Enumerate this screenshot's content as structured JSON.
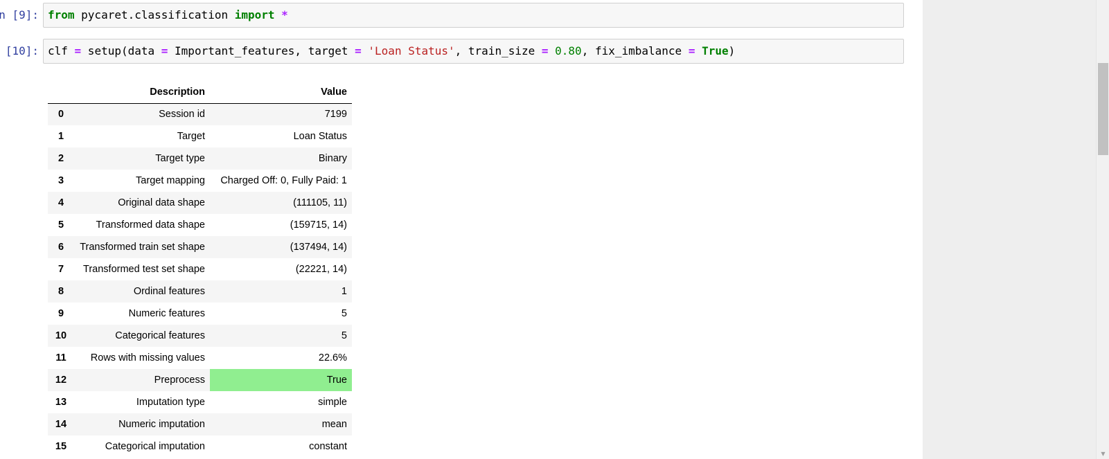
{
  "cells": [
    {
      "prompt": "n [9]:",
      "code": [
        {
          "t": "from",
          "c": "kw"
        },
        {
          "t": " pycaret.classification ",
          "c": ""
        },
        {
          "t": "import",
          "c": "kw"
        },
        {
          "t": " ",
          "c": ""
        },
        {
          "t": "*",
          "c": "op"
        }
      ]
    },
    {
      "prompt": "[10]:",
      "code": [
        {
          "t": "clf ",
          "c": ""
        },
        {
          "t": "=",
          "c": "op"
        },
        {
          "t": " setup(data ",
          "c": ""
        },
        {
          "t": "=",
          "c": "op"
        },
        {
          "t": " Important_features, target ",
          "c": ""
        },
        {
          "t": "=",
          "c": "op"
        },
        {
          "t": " ",
          "c": ""
        },
        {
          "t": "'Loan Status'",
          "c": "str"
        },
        {
          "t": ", train_size ",
          "c": ""
        },
        {
          "t": "=",
          "c": "op"
        },
        {
          "t": " ",
          "c": ""
        },
        {
          "t": "0.80",
          "c": "num"
        },
        {
          "t": ", fix_imbalance ",
          "c": ""
        },
        {
          "t": "=",
          "c": "op"
        },
        {
          "t": " ",
          "c": ""
        },
        {
          "t": "True",
          "c": "kw"
        },
        {
          "t": ")",
          "c": ""
        }
      ]
    }
  ],
  "table": {
    "headers": {
      "index": "",
      "description": "Description",
      "value": "Value"
    },
    "rows": [
      {
        "index": "0",
        "description": "Session id",
        "value": "7199",
        "highlight": false
      },
      {
        "index": "1",
        "description": "Target",
        "value": "Loan Status",
        "highlight": false
      },
      {
        "index": "2",
        "description": "Target type",
        "value": "Binary",
        "highlight": false
      },
      {
        "index": "3",
        "description": "Target mapping",
        "value": "Charged Off: 0, Fully Paid: 1",
        "highlight": false
      },
      {
        "index": "4",
        "description": "Original data shape",
        "value": "(111105, 11)",
        "highlight": false
      },
      {
        "index": "5",
        "description": "Transformed data shape",
        "value": "(159715, 14)",
        "highlight": false
      },
      {
        "index": "6",
        "description": "Transformed train set shape",
        "value": "(137494, 14)",
        "highlight": false
      },
      {
        "index": "7",
        "description": "Transformed test set shape",
        "value": "(22221, 14)",
        "highlight": false
      },
      {
        "index": "8",
        "description": "Ordinal features",
        "value": "1",
        "highlight": false
      },
      {
        "index": "9",
        "description": "Numeric features",
        "value": "5",
        "highlight": false
      },
      {
        "index": "10",
        "description": "Categorical features",
        "value": "5",
        "highlight": false
      },
      {
        "index": "11",
        "description": "Rows with missing values",
        "value": "22.6%",
        "highlight": false
      },
      {
        "index": "12",
        "description": "Preprocess",
        "value": "True",
        "highlight": true
      },
      {
        "index": "13",
        "description": "Imputation type",
        "value": "simple",
        "highlight": false
      },
      {
        "index": "14",
        "description": "Numeric imputation",
        "value": "mean",
        "highlight": false
      },
      {
        "index": "15",
        "description": "Categorical imputation",
        "value": "constant",
        "highlight": false
      }
    ],
    "highlight_color": "#90ee90"
  },
  "colors": {
    "prompt": "#303f9f",
    "keyword": "#008000",
    "operator": "#aa22ff",
    "string": "#ba2121",
    "number": "#008000",
    "cell_background": "#f7f7f7",
    "gutter": "#eeeeee"
  }
}
